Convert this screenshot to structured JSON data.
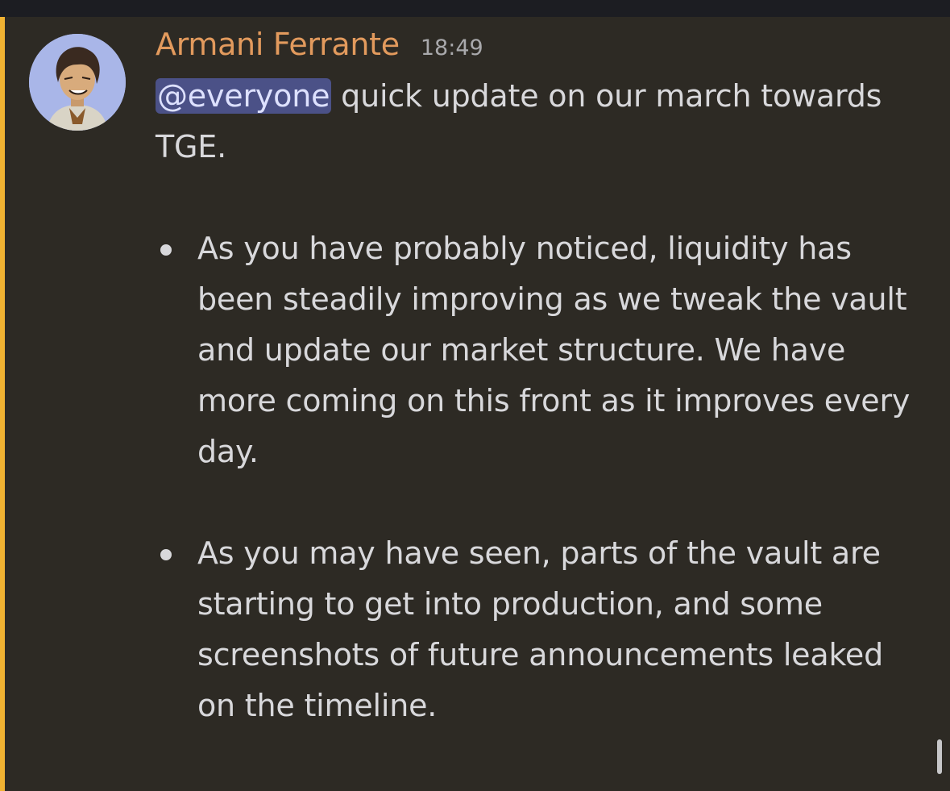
{
  "message": {
    "author": "Armani Ferrante",
    "timestamp": "18:49",
    "mention": "@everyone",
    "intro": " quick update on our march towards TGE.",
    "bullets": [
      "As you have probably noticed, liquidity has been steadily improving as we tweak the vault and update our market structure. We have more coming on this front as it improves every day.",
      "As you may have seen, parts of the vault are starting to get into production, and some screenshots of future announcements leaked on the timeline."
    ]
  },
  "colors": {
    "background": "#2d2a24",
    "highlight_bar": "#f0b232",
    "username": "#e29a5d",
    "mention_bg": "#4b5187",
    "text": "#d8d8db"
  },
  "icons": {
    "avatar": "user-avatar-illustration",
    "bullet": "bullet-dot"
  }
}
